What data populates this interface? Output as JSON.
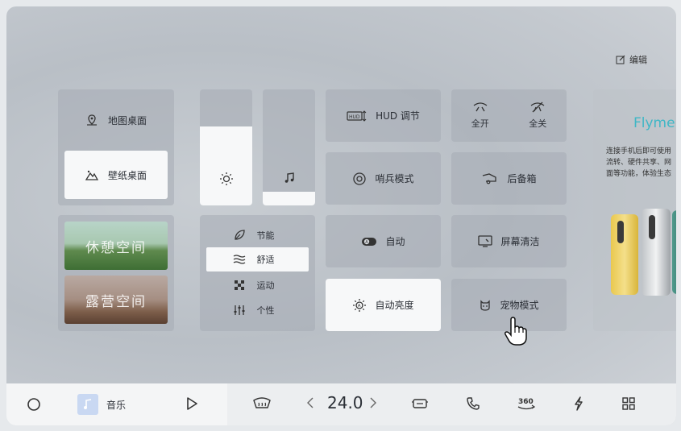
{
  "header": {
    "edit_label": "编辑"
  },
  "desktop": {
    "map_label": "地图桌面",
    "wallpaper_label": "壁纸桌面"
  },
  "spaces": {
    "rest_label": "休憩空间",
    "camp_label": "露营空间"
  },
  "sliders": {
    "brightness_level": 0.68,
    "volume_level": 0.12
  },
  "drive_modes": {
    "items": [
      {
        "label": "节能",
        "icon": "leaf-icon"
      },
      {
        "label": "舒适",
        "icon": "waves-icon"
      },
      {
        "label": "运动",
        "icon": "checker-icon"
      },
      {
        "label": "个性",
        "icon": "sliders-icon"
      }
    ],
    "active": "舒适"
  },
  "tiles": {
    "hud_label": "HUD 调节",
    "sentry_label": "哨兵模式",
    "auto_label": "自动",
    "auto_brightness_label": "自动亮度",
    "mirror_open_label": "全开",
    "mirror_close_label": "全关",
    "trunk_label": "后备箱",
    "screen_clean_label": "屏幕清洁",
    "pet_mode_label": "宠物模式"
  },
  "flyme": {
    "brand": "Flyme",
    "desc_lines": [
      "连接手机后即可使用",
      "流转、硬件共享、网",
      "面等功能，体验生态"
    ]
  },
  "dock": {
    "music_label": "音乐",
    "temperature": "24.0"
  },
  "colors": {
    "accent_teal": "#3fb7c6",
    "tile_white": "#f7f8f9"
  }
}
